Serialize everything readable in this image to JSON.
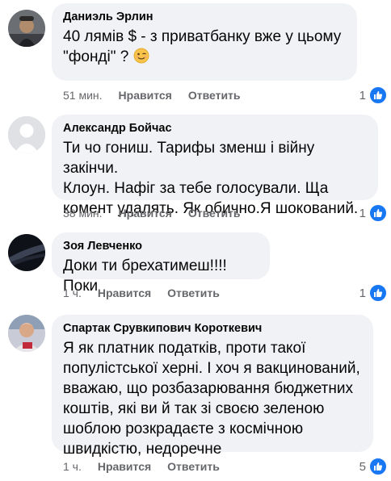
{
  "comments": [
    {
      "author": "Даниэль Эрлин",
      "text_lines": [
        "40 лямів $ - з приватбанку вже у цьому",
        "\"фонді\" ?"
      ],
      "emoji": "winking-face",
      "time": "51 мин.",
      "like_label": "Нравится",
      "reply_label": "Ответить",
      "like_count": "1"
    },
    {
      "author": "Александр Бойчас",
      "text_lines": [
        "Ти чо гониш. Тарифы зменш і війну закінчи.",
        "Клоун. Нафіг за тебе голосували. Ща",
        "комент удалять. Як обично.Я шокований."
      ],
      "time": "38 мин.",
      "like_label": "Нравится",
      "reply_label": "Ответить",
      "like_count": "1"
    },
    {
      "author": "Зоя Левченко",
      "text_lines": [
        "Доки ти брехатимеш!!!!Поки"
      ],
      "time": "1 ч.",
      "like_label": "Нравится",
      "reply_label": "Ответить",
      "like_count": "1"
    },
    {
      "author": "Спартак Срувкипович Короткевич",
      "text_lines": [
        "Я як платник податків, проти такої",
        "популістської херні. І хоч я вакцинований,",
        "вважаю, що розбазарювання бюджетних",
        "коштів, які ви й так зі своєю зеленою",
        "шоблою розкрадаєте з космічною",
        "швидкістю, недоречне"
      ],
      "time": "1 ч.",
      "like_label": "Нравится",
      "reply_label": "Ответить",
      "like_count": "5"
    }
  ],
  "colors": {
    "bubble": "#f0f2f5",
    "meta_text": "#65676b",
    "like_blue": "#1877f2"
  },
  "icons": {
    "like": "thumbs-up-icon",
    "emoji": "winking-face-icon"
  }
}
